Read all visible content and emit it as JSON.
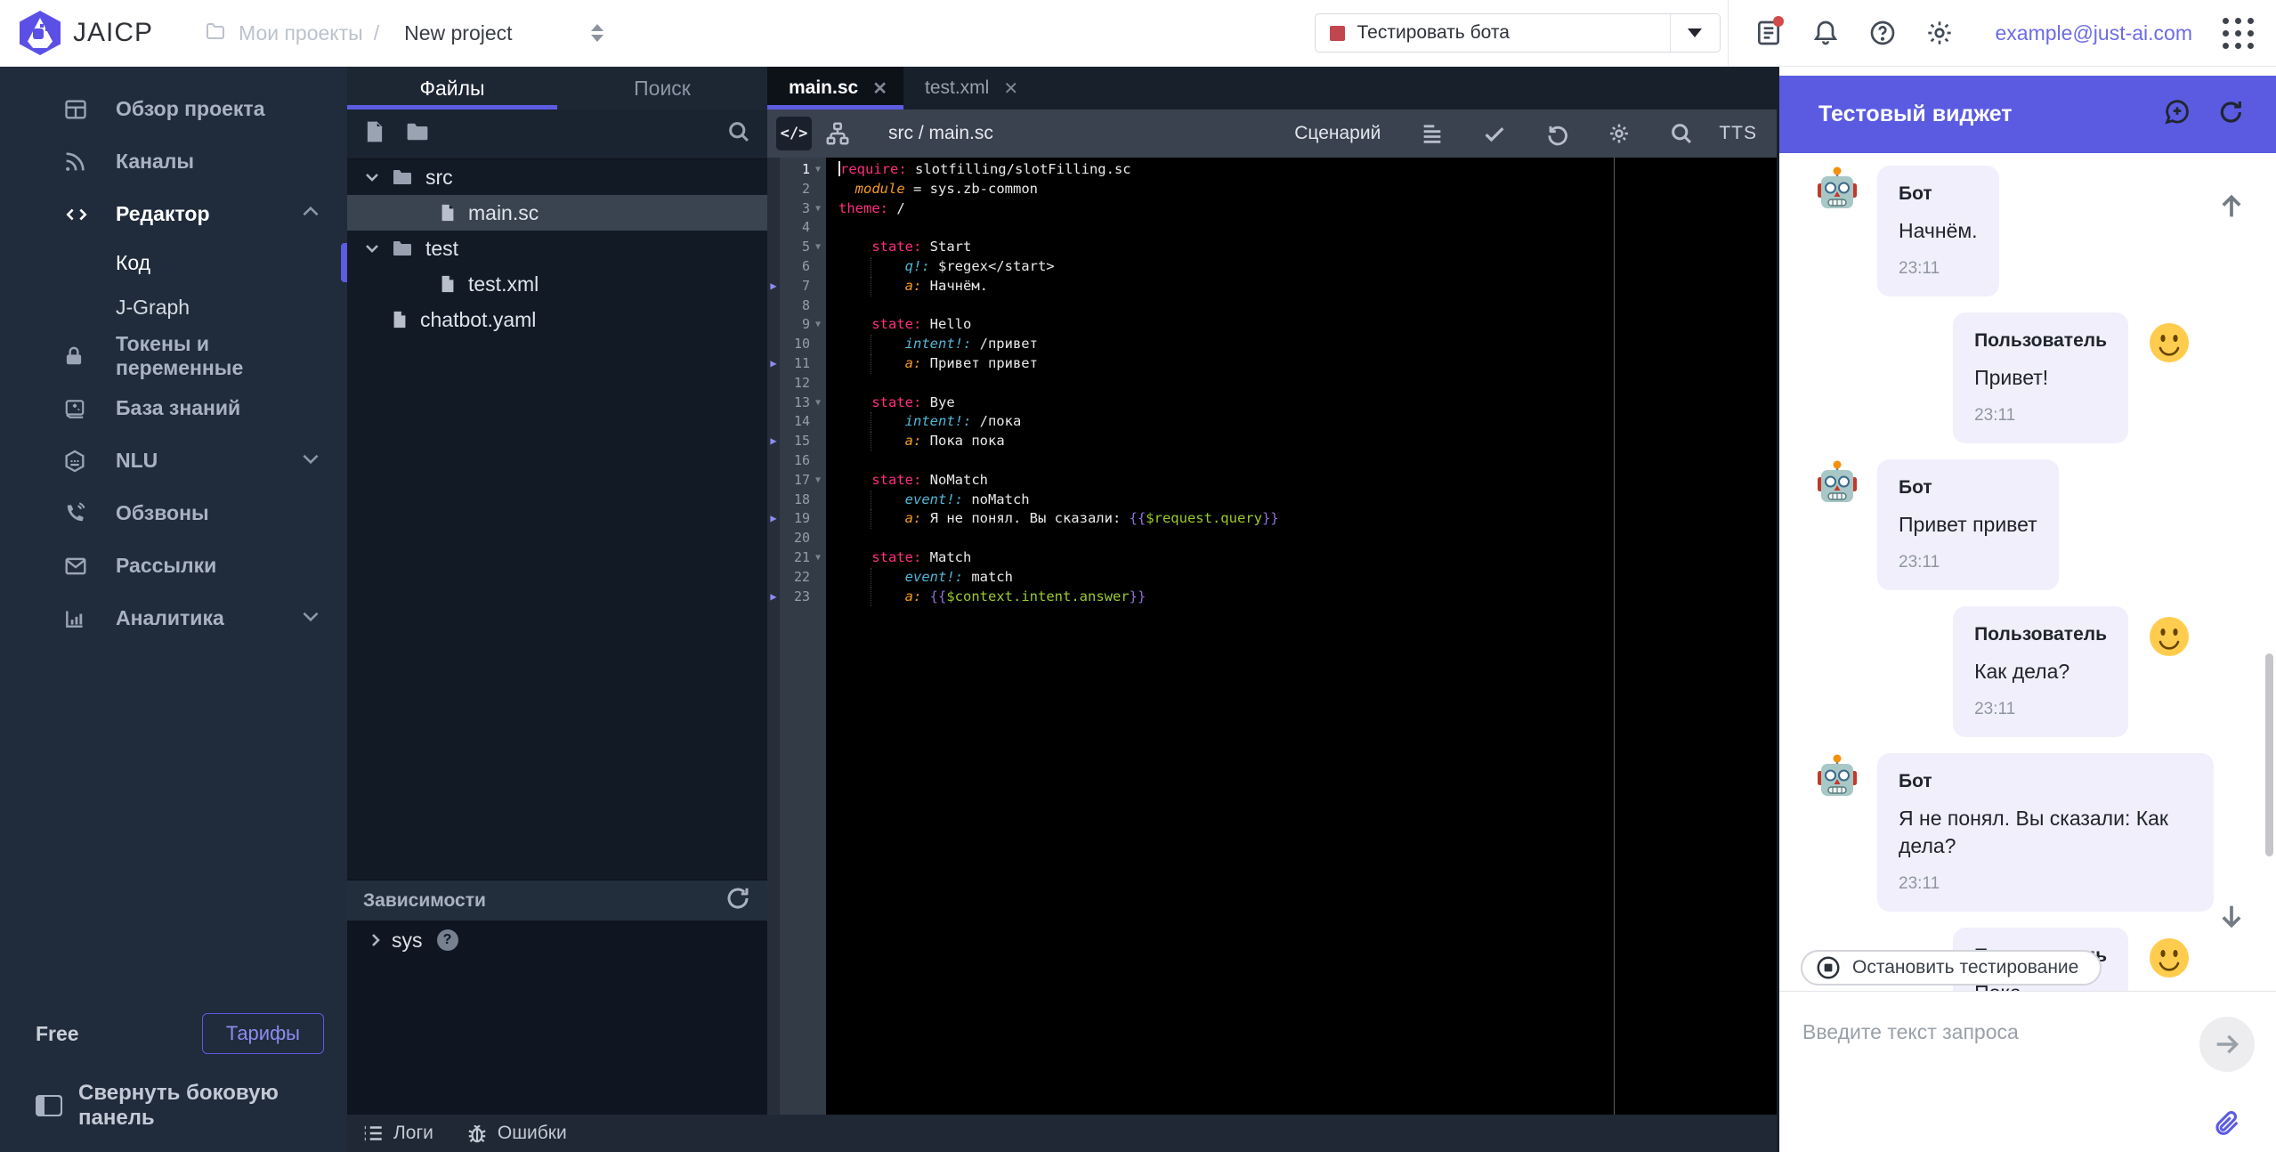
{
  "colors": {
    "accent": "#5b5ce0",
    "chat_header": "#5a5be0",
    "bubble": "#f1effb",
    "test_button_square": "#c2464e",
    "code_key": "#ff2e7d",
    "code_attr": "#f59b1f",
    "code_tag": "#52b8d8",
    "code_var": "#9ac92a",
    "code_brace": "#8f6fd8"
  },
  "topbar": {
    "app_name": "JAICP",
    "breadcrumb": {
      "folder": "Мои проекты",
      "separator": "/",
      "project": "New project"
    },
    "test_button_label": "Тестировать бота",
    "email": "example@just-ai.com"
  },
  "sidebar": {
    "items": [
      {
        "label": "Обзор проекта",
        "icon": "grid"
      },
      {
        "label": "Каналы",
        "icon": "rss"
      },
      {
        "label": "Редактор",
        "icon": "code",
        "expanded": true,
        "chevron": "up",
        "children": [
          {
            "label": "Код",
            "active": true
          },
          {
            "label": "J-Graph"
          }
        ]
      },
      {
        "label": "Токены и переменные",
        "icon": "lock"
      },
      {
        "label": "База знаний",
        "icon": "book"
      },
      {
        "label": "NLU",
        "icon": "robot",
        "chevron": "down"
      },
      {
        "label": "Обзвоны",
        "icon": "phone"
      },
      {
        "label": "Рассылки",
        "icon": "mail"
      },
      {
        "label": "Аналитика",
        "icon": "chart",
        "chevron": "down"
      }
    ],
    "footer": {
      "plan": "Free",
      "plans_button": "Тарифы",
      "collapse": "Свернуть боковую панель"
    }
  },
  "file_panel": {
    "tabs": [
      {
        "label": "Файлы",
        "active": true
      },
      {
        "label": "Поиск"
      }
    ],
    "tree": [
      {
        "type": "folder",
        "label": "src",
        "depth": 0,
        "expanded": true
      },
      {
        "type": "file",
        "label": "main.sc",
        "depth": 1,
        "selected": true
      },
      {
        "type": "folder",
        "label": "test",
        "depth": 0,
        "expanded": true
      },
      {
        "type": "file",
        "label": "test.xml",
        "depth": 1
      },
      {
        "type": "file",
        "label": "chatbot.yaml",
        "depth": 0
      }
    ],
    "dependencies": {
      "title": "Зависимости",
      "items": [
        {
          "label": "sys"
        }
      ]
    }
  },
  "editor": {
    "tabs": [
      {
        "label": "main.sc",
        "active": true
      },
      {
        "label": "test.xml"
      }
    ],
    "toolbar": {
      "breadcrumb": "src / main.sc",
      "mode": "Сценарий",
      "tts": "TTS"
    },
    "code_lines": [
      {
        "n": 1,
        "fold": true,
        "cursor": true,
        "tokens": [
          [
            "key",
            "require:"
          ],
          [
            "plain",
            " slotfilling/slotFilling.sc"
          ]
        ]
      },
      {
        "n": 2,
        "tokens": [
          [
            "plain",
            "  "
          ],
          [
            "attr",
            "module"
          ],
          [
            "plain",
            " = sys.zb-common"
          ]
        ]
      },
      {
        "n": 3,
        "fold": true,
        "tokens": [
          [
            "key",
            "theme:"
          ],
          [
            "plain",
            " /"
          ]
        ]
      },
      {
        "n": 4,
        "tokens": []
      },
      {
        "n": 5,
        "fold": true,
        "tokens": [
          [
            "plain",
            "    "
          ],
          [
            "key",
            "state:"
          ],
          [
            "plain",
            " Start"
          ]
        ]
      },
      {
        "n": 6,
        "guide": true,
        "tokens": [
          [
            "plain",
            "        "
          ],
          [
            "q",
            "q!:"
          ],
          [
            "plain",
            " $regex</start>"
          ]
        ]
      },
      {
        "n": 7,
        "bp": true,
        "guide": true,
        "tokens": [
          [
            "plain",
            "        "
          ],
          [
            "attr",
            "a:"
          ],
          [
            "plain",
            " Начнём."
          ]
        ]
      },
      {
        "n": 8,
        "tokens": []
      },
      {
        "n": 9,
        "fold": true,
        "tokens": [
          [
            "plain",
            "    "
          ],
          [
            "key",
            "state:"
          ],
          [
            "plain",
            " Hello"
          ]
        ]
      },
      {
        "n": 10,
        "guide": true,
        "tokens": [
          [
            "plain",
            "        "
          ],
          [
            "q",
            "intent!:"
          ],
          [
            "plain",
            " /привет"
          ]
        ]
      },
      {
        "n": 11,
        "bp": true,
        "guide": true,
        "tokens": [
          [
            "plain",
            "        "
          ],
          [
            "attr",
            "a:"
          ],
          [
            "plain",
            " Привет привет"
          ]
        ]
      },
      {
        "n": 12,
        "tokens": []
      },
      {
        "n": 13,
        "fold": true,
        "tokens": [
          [
            "plain",
            "    "
          ],
          [
            "key",
            "state:"
          ],
          [
            "plain",
            " Bye"
          ]
        ]
      },
      {
        "n": 14,
        "guide": true,
        "tokens": [
          [
            "plain",
            "        "
          ],
          [
            "q",
            "intent!:"
          ],
          [
            "plain",
            " /пока"
          ]
        ]
      },
      {
        "n": 15,
        "bp": true,
        "guide": true,
        "tokens": [
          [
            "plain",
            "        "
          ],
          [
            "attr",
            "a:"
          ],
          [
            "plain",
            " Пока пока"
          ]
        ]
      },
      {
        "n": 16,
        "tokens": []
      },
      {
        "n": 17,
        "fold": true,
        "tokens": [
          [
            "plain",
            "    "
          ],
          [
            "key",
            "state:"
          ],
          [
            "plain",
            " NoMatch"
          ]
        ]
      },
      {
        "n": 18,
        "guide": true,
        "tokens": [
          [
            "plain",
            "        "
          ],
          [
            "q",
            "event!:"
          ],
          [
            "plain",
            " noMatch"
          ]
        ]
      },
      {
        "n": 19,
        "bp": true,
        "guide": true,
        "tokens": [
          [
            "plain",
            "        "
          ],
          [
            "attr",
            "a:"
          ],
          [
            "plain",
            " Я не понял. Вы сказали: "
          ],
          [
            "brace",
            "{{"
          ],
          [
            "var",
            "$request.query"
          ],
          [
            "brace",
            "}}"
          ]
        ]
      },
      {
        "n": 20,
        "tokens": []
      },
      {
        "n": 21,
        "fold": true,
        "tokens": [
          [
            "plain",
            "    "
          ],
          [
            "key",
            "state:"
          ],
          [
            "plain",
            " Match"
          ]
        ]
      },
      {
        "n": 22,
        "guide": true,
        "tokens": [
          [
            "plain",
            "        "
          ],
          [
            "q",
            "event!:"
          ],
          [
            "plain",
            " match"
          ]
        ]
      },
      {
        "n": 23,
        "bp": true,
        "guide": true,
        "tokens": [
          [
            "plain",
            "        "
          ],
          [
            "attr",
            "a:"
          ],
          [
            "plain",
            " "
          ],
          [
            "brace",
            "{{"
          ],
          [
            "var",
            "$context.intent.answer"
          ],
          [
            "brace",
            "}}"
          ]
        ]
      }
    ]
  },
  "bottom_bar": {
    "logs": "Логи",
    "errors": "Ошибки"
  },
  "chat": {
    "title": "Тестовый виджет",
    "messages": [
      {
        "who": "bot",
        "name": "Бот",
        "text": "Начнём.",
        "time": "23:11"
      },
      {
        "who": "user",
        "name": "Пользователь",
        "text": "Привет!",
        "time": "23:11"
      },
      {
        "who": "bot",
        "name": "Бот",
        "text": "Привет привет",
        "time": "23:11"
      },
      {
        "who": "user",
        "name": "Пользователь",
        "text": "Как дела?",
        "time": "23:11"
      },
      {
        "who": "bot",
        "name": "Бот",
        "text": "Я не понял. Вы сказали: Как дела?",
        "time": "23:11"
      },
      {
        "who": "user",
        "name": "Пользователь",
        "text": "Пока",
        "time": ""
      }
    ],
    "stop_button": "Остановить тестирование",
    "input_placeholder": "Введите текст запроса"
  }
}
